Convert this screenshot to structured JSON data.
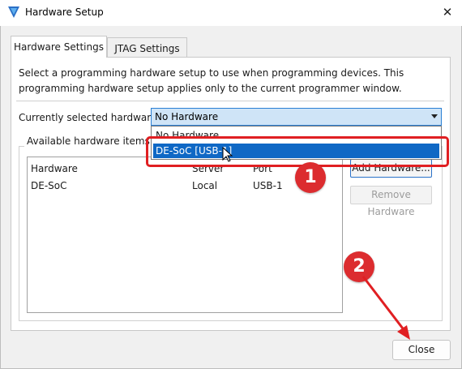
{
  "window": {
    "title": "Hardware Setup",
    "close_glyph": "✕"
  },
  "tabs": [
    {
      "label": "Hardware Settings",
      "active": true
    },
    {
      "label": "JTAG Settings",
      "active": false
    }
  ],
  "hardware_settings": {
    "description": "Select a programming hardware setup to use when programming devices. This programming hardware setup applies only to the current programmer window.",
    "selected_label": "Currently selected hardware:",
    "selected_value": "No Hardware",
    "dropdown_options": [
      {
        "label": "No Hardware",
        "selected": false
      },
      {
        "label": "DE-SoC [USB-1]",
        "selected": true
      }
    ],
    "available_label": "Available hardware items",
    "columns": [
      "Hardware",
      "Server",
      "Port"
    ],
    "rows": [
      [
        "DE-SoC",
        "Local",
        "USB-1"
      ]
    ],
    "add_button": "Add Hardware...",
    "remove_button": "Remove Hardware"
  },
  "footer": {
    "close_button": "Close"
  },
  "annotations": {
    "badge_1": "1",
    "badge_2": "2",
    "color": "#dc2c2f"
  },
  "colors": {
    "accent": "#0f68c5",
    "annotation_red": "#e01f22"
  }
}
